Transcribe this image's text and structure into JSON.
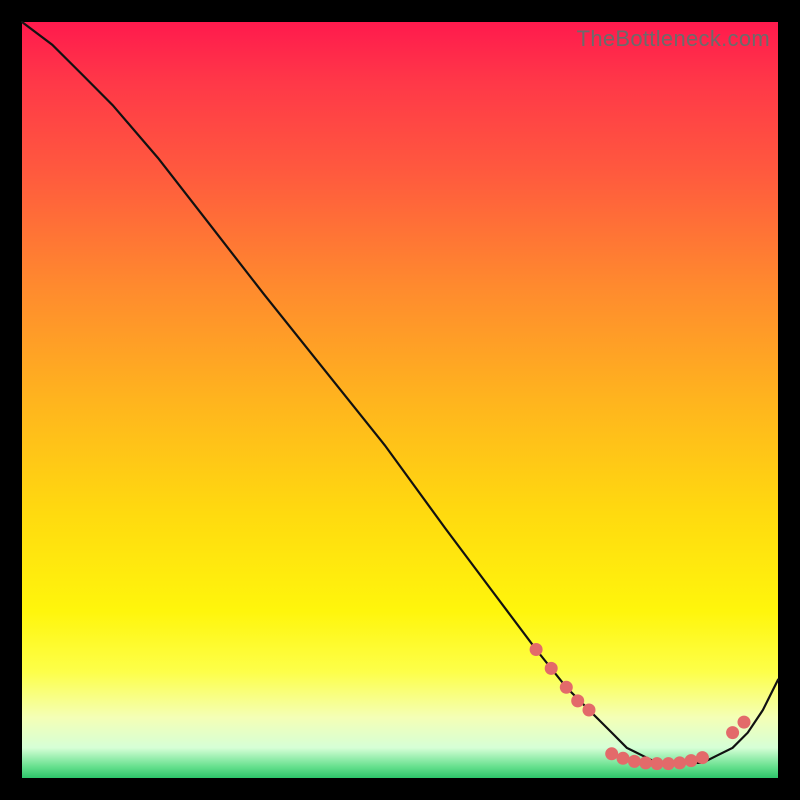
{
  "watermark": "TheBottleneck.com",
  "colors": {
    "background": "#000000",
    "gradient_top": "#ff1a4d",
    "gradient_mid": "#ffda0f",
    "gradient_bottom": "#2ec46a",
    "curve": "#111111",
    "marker": "#e36a6a"
  },
  "chart_data": {
    "type": "line",
    "title": "",
    "xlabel": "",
    "ylabel": "",
    "xlim": [
      0,
      100
    ],
    "ylim": [
      0,
      100
    ],
    "series": [
      {
        "name": "bottleneck-curve",
        "x": [
          0,
          4,
          8,
          12,
          18,
          25,
          32,
          40,
          48,
          56,
          62,
          68,
          72,
          75,
          78,
          80,
          82,
          84,
          86,
          88,
          90,
          92,
          94,
          96,
          98,
          100
        ],
        "y": [
          100,
          97,
          93,
          89,
          82,
          73,
          64,
          54,
          44,
          33,
          25,
          17,
          12,
          9,
          6,
          4,
          3,
          2,
          2,
          2,
          2,
          3,
          4,
          6,
          9,
          13
        ]
      }
    ],
    "markers": {
      "name": "highlight-dots",
      "points": [
        {
          "x": 68,
          "y": 17
        },
        {
          "x": 70,
          "y": 14.5
        },
        {
          "x": 72,
          "y": 12
        },
        {
          "x": 73.5,
          "y": 10.2
        },
        {
          "x": 75,
          "y": 9
        },
        {
          "x": 78,
          "y": 3.2
        },
        {
          "x": 79.5,
          "y": 2.6
        },
        {
          "x": 81,
          "y": 2.2
        },
        {
          "x": 82.5,
          "y": 2.0
        },
        {
          "x": 84,
          "y": 1.9
        },
        {
          "x": 85.5,
          "y": 1.9
        },
        {
          "x": 87,
          "y": 2.0
        },
        {
          "x": 88.5,
          "y": 2.3
        },
        {
          "x": 90,
          "y": 2.7
        },
        {
          "x": 94,
          "y": 6.0
        },
        {
          "x": 95.5,
          "y": 7.4
        }
      ]
    }
  }
}
